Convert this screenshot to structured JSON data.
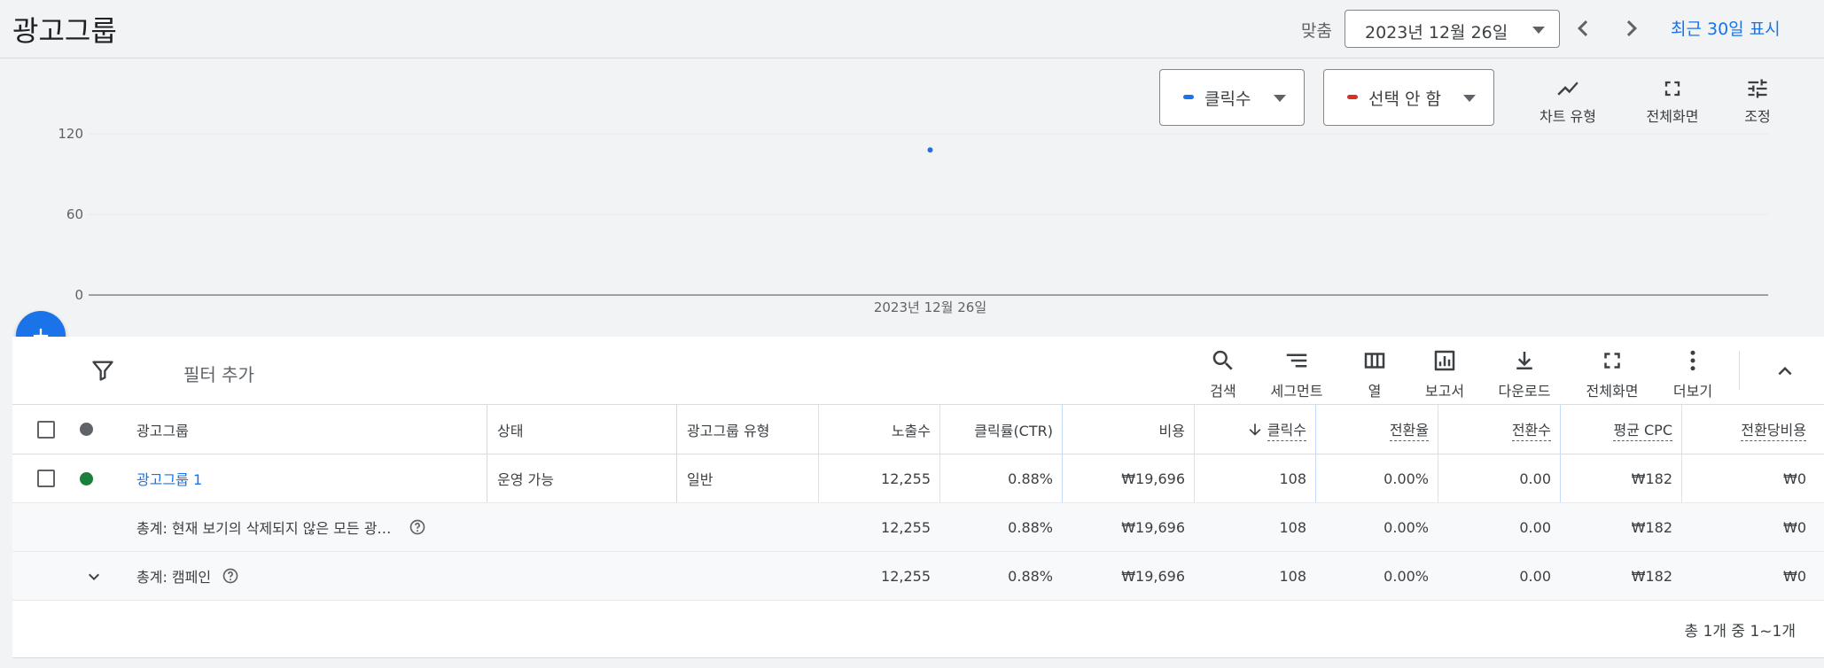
{
  "header": {
    "title": "광고그룹",
    "fit_label": "맞춤",
    "date_value": "2023년 12월 26일",
    "recent_link": "최근 30일 표시"
  },
  "chart_controls": {
    "metric1": {
      "label": "클릭수",
      "color": "#1a73e8"
    },
    "metric2": {
      "label": "선택 안 함",
      "color": "#d93025"
    },
    "tools": [
      {
        "label": "차트 유형",
        "icon": "line-chart-icon"
      },
      {
        "label": "전체화면",
        "icon": "fullscreen-icon"
      },
      {
        "label": "조정",
        "icon": "tune-icon"
      }
    ]
  },
  "chart_data": {
    "type": "scatter",
    "x": [
      "2023년 12월 26일"
    ],
    "y": [
      108
    ],
    "ylim": [
      0,
      120
    ],
    "yticks": [
      "0",
      "60",
      "120"
    ],
    "xticks": [
      "2023년 12월 26일"
    ],
    "grid": true,
    "series": [
      {
        "values": [
          108
        ],
        "color": "#1a73e8"
      }
    ]
  },
  "toolbar": {
    "filter_placeholder": "필터 추가",
    "tools": [
      {
        "label": "검색",
        "icon": "search-icon"
      },
      {
        "label": "세그먼트",
        "icon": "segment-icon"
      },
      {
        "label": "열",
        "icon": "columns-icon"
      },
      {
        "label": "보고서",
        "icon": "report-icon"
      },
      {
        "label": "다운로드",
        "icon": "download-icon"
      },
      {
        "label": "전체화면",
        "icon": "fullscreen-icon"
      },
      {
        "label": "더보기",
        "icon": "more-vert-icon"
      }
    ]
  },
  "table": {
    "headers": {
      "adgroup": "광고그룹",
      "status": "상태",
      "type": "광고그룹 유형",
      "impressions": "노출수",
      "ctr": "클릭률(CTR)",
      "cost": "비용",
      "clicks": "클릭수",
      "conv_rate": "전환율",
      "conversions": "전환수",
      "avg_cpc": "평균 CPC",
      "cost_per_conv": "전환당비용"
    },
    "rows": [
      {
        "adgroup": "광고그룹 1",
        "status": "운영 가능",
        "type": "일반",
        "impressions": "12,255",
        "ctr": "0.88%",
        "cost": "₩19,696",
        "clicks": "108",
        "conv_rate": "0.00%",
        "conversions": "0.00",
        "avg_cpc": "₩182",
        "cost_per_conv": "₩0",
        "status_color": "#188038"
      }
    ],
    "totals": [
      {
        "label": "총계: 현재 보기의 삭제되지 않은 모든 광…",
        "impressions": "12,255",
        "ctr": "0.88%",
        "cost": "₩19,696",
        "clicks": "108",
        "conv_rate": "0.00%",
        "conversions": "0.00",
        "avg_cpc": "₩182",
        "cost_per_conv": "₩0"
      },
      {
        "label": "총계: 캠페인",
        "impressions": "12,255",
        "ctr": "0.88%",
        "cost": "₩19,696",
        "clicks": "108",
        "conv_rate": "0.00%",
        "conversions": "0.00",
        "avg_cpc": "₩182",
        "cost_per_conv": "₩0"
      }
    ],
    "pagination": "총 1개 중 1~1개"
  }
}
